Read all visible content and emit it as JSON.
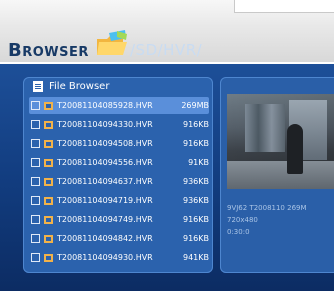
{
  "header": {
    "app_title": "Browser",
    "path": "/SD/HVR/"
  },
  "list": {
    "title": "File Browser",
    "rows": [
      {
        "name": "T20081104085928.HVR",
        "size": "269MB",
        "selected": true
      },
      {
        "name": "T20081104094330.HVR",
        "size": "916KB",
        "selected": false
      },
      {
        "name": "T20081104094508.HVR",
        "size": "916KB",
        "selected": false
      },
      {
        "name": "T20081104094556.HVR",
        "size": "91KB",
        "selected": false
      },
      {
        "name": "T20081104094637.HVR",
        "size": "936KB",
        "selected": false
      },
      {
        "name": "T20081104094719.HVR",
        "size": "936KB",
        "selected": false
      },
      {
        "name": "T20081104094749.HVR",
        "size": "916KB",
        "selected": false
      },
      {
        "name": "T20081104094842.HVR",
        "size": "916KB",
        "selected": false
      },
      {
        "name": "T20081104094930.HVR",
        "size": "941KB",
        "selected": false
      }
    ]
  },
  "preview": {
    "line1": "9VJ62  T2008110  269M",
    "line2": "720x480",
    "line3": "0:30:0"
  },
  "colors": {
    "title": "#183a66",
    "panel": "#2b62ad",
    "selected_row": "#5a8fda",
    "background": "#123d80"
  },
  "icons": {
    "header": "folder-icon",
    "list_header": "file-list-icon",
    "row": "video-file-icon"
  }
}
